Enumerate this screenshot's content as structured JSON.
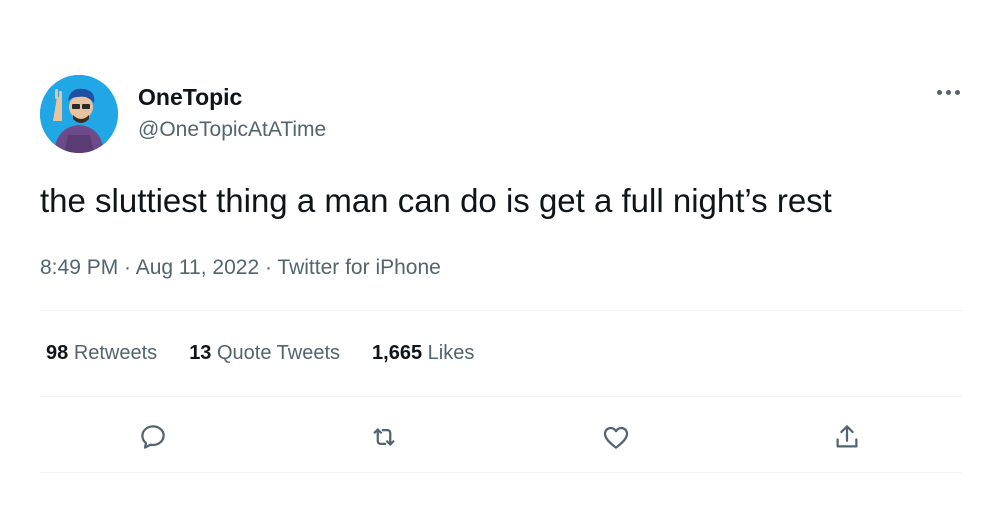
{
  "author": {
    "display_name": "OneTopic",
    "handle": "@OneTopicAtATime",
    "avatar_icon": "avatar-icon"
  },
  "tweet": {
    "text": "the sluttiest thing a man can do is get a full night’s rest",
    "time": "8:49 PM",
    "date": "Aug 11, 2022",
    "source": "Twitter for iPhone",
    "separator": " · "
  },
  "stats": {
    "retweets_count": "98",
    "retweets_label": "Retweets",
    "quotes_count": "13",
    "quotes_label": "Quote Tweets",
    "likes_count": "1,665",
    "likes_label": "Likes"
  },
  "actions": [
    "reply-icon",
    "retweet-icon",
    "like-icon",
    "share-icon"
  ],
  "colors": {
    "text_primary": "#0f1419",
    "text_secondary": "#536471",
    "divider": "#eff3f4",
    "avatar_bg": "#1da1f2"
  }
}
